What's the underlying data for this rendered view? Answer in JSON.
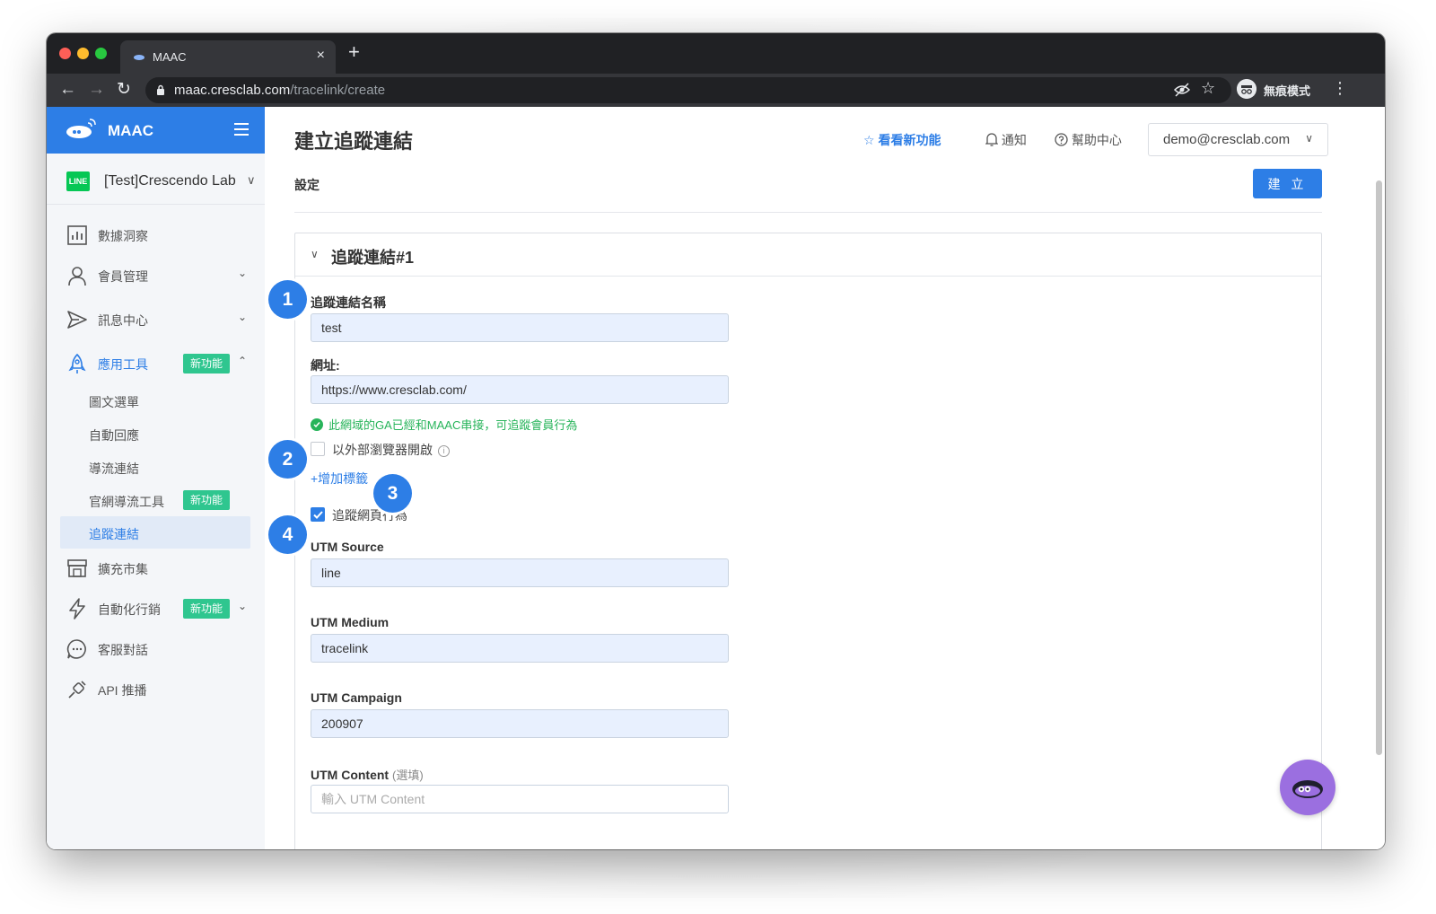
{
  "browser": {
    "tab_title": "MAAC",
    "tab_close": "×",
    "new_tab": "+",
    "url_host": "maac.cresclab.com",
    "url_path": "/tracelink/create",
    "incognito_label": "無痕模式"
  },
  "sidebar": {
    "brand": "MAAC",
    "account_badge": "LINE",
    "account_name": "[Test]Crescendo Lab",
    "new_badge": "新功能",
    "items": [
      {
        "label": "數據洞察",
        "icon": "chart-icon"
      },
      {
        "label": "會員管理",
        "icon": "user-icon",
        "expandable": true
      },
      {
        "label": "訊息中心",
        "icon": "send-icon",
        "expandable": true
      },
      {
        "label": "應用工具",
        "icon": "rocket-icon",
        "active": true,
        "badge": "新功能",
        "expanded": true
      },
      {
        "label": "擴充市集",
        "icon": "store-icon"
      },
      {
        "label": "自動化行銷",
        "icon": "bolt-icon",
        "badge": "新功能",
        "expandable": true
      },
      {
        "label": "客服對話",
        "icon": "chat-icon"
      },
      {
        "label": "API 推播",
        "icon": "plug-icon"
      }
    ],
    "sub_items": [
      {
        "label": "圖文選單"
      },
      {
        "label": "自動回應"
      },
      {
        "label": "導流連結"
      },
      {
        "label": "官網導流工具",
        "badge": "新功能"
      },
      {
        "label": "追蹤連結",
        "selected": true
      }
    ]
  },
  "header": {
    "title": "建立追蹤連結",
    "whats_new": "看看新功能",
    "notifications": "通知",
    "help": "幫助中心",
    "user": "demo@cresclab.com"
  },
  "subnav": {
    "settings": "設定",
    "create_button": "建 立"
  },
  "form": {
    "card_title": "追蹤連結#1",
    "name_label": "追蹤連結名稱",
    "name_value": "test",
    "url_label": "網址:",
    "url_value": "https://www.cresclab.com/",
    "ga_status": "此網域的GA已經和MAAC串接，可追蹤會員行為",
    "external_browser_label": "以外部瀏覽器開啟",
    "external_browser_checked": false,
    "info_glyph": "i",
    "add_tag": "+增加標籤",
    "track_web_label": "追蹤網頁行為",
    "track_web_checked": true,
    "utm_source_label": "UTM Source",
    "utm_source_value": "line",
    "utm_medium_label": "UTM Medium",
    "utm_medium_value": "tracelink",
    "utm_campaign_label": "UTM Campaign",
    "utm_campaign_value": "200907",
    "utm_content_label": "UTM Content",
    "utm_content_optional": "(選填)",
    "utm_content_placeholder": "輸入 UTM Content"
  },
  "callouts": [
    "1",
    "2",
    "3",
    "4"
  ],
  "colors": {
    "primary": "#2d7ee6",
    "success": "#27b45a",
    "badge": "#2fc68f",
    "chat_fab": "#9b6fe0"
  }
}
